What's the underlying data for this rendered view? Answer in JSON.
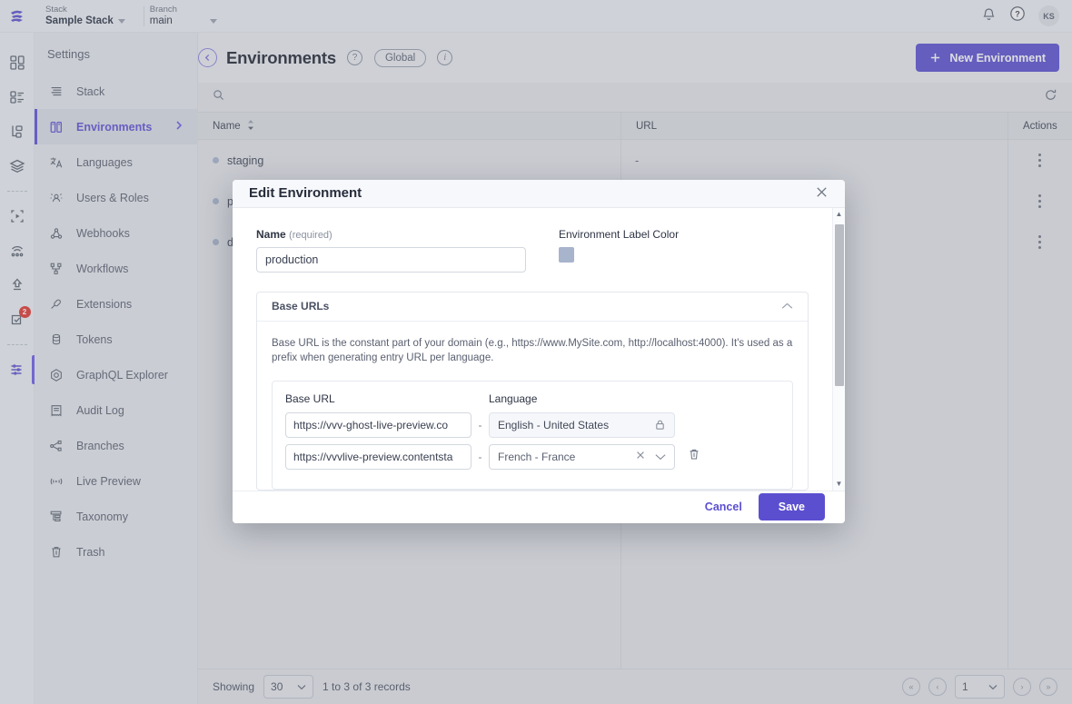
{
  "topbar": {
    "stack_label": "Stack",
    "stack_value": "Sample Stack",
    "branch_label": "Branch",
    "branch_value": "main",
    "avatar_initials": "KS"
  },
  "rail": {
    "items": [
      {
        "name": "dashboard-icon"
      },
      {
        "name": "content-types-icon"
      },
      {
        "name": "entries-icon"
      },
      {
        "name": "assets-icon"
      },
      {
        "name": "live-preview-icon"
      },
      {
        "name": "releases-icon"
      },
      {
        "name": "publish-queue-icon"
      },
      {
        "name": "tasks-icon",
        "badge": "2"
      },
      {
        "name": "settings-icon"
      }
    ]
  },
  "sidebar": {
    "title": "Settings",
    "items": [
      {
        "label": "Stack",
        "icon": "stack-icon",
        "active": false
      },
      {
        "label": "Environments",
        "icon": "environments-icon",
        "active": true
      },
      {
        "label": "Languages",
        "icon": "languages-icon",
        "active": false
      },
      {
        "label": "Users & Roles",
        "icon": "users-roles-icon",
        "active": false
      },
      {
        "label": "Webhooks",
        "icon": "webhooks-icon",
        "active": false
      },
      {
        "label": "Workflows",
        "icon": "workflows-icon",
        "active": false
      },
      {
        "label": "Extensions",
        "icon": "extensions-icon",
        "active": false
      },
      {
        "label": "Tokens",
        "icon": "tokens-icon",
        "active": false
      },
      {
        "label": "GraphQL Explorer",
        "icon": "graphql-icon",
        "active": false
      },
      {
        "label": "Audit Log",
        "icon": "audit-log-icon",
        "active": false
      },
      {
        "label": "Branches",
        "icon": "branches-icon",
        "active": false
      },
      {
        "label": "Live Preview",
        "icon": "live-preview-icon",
        "active": false
      },
      {
        "label": "Taxonomy",
        "icon": "taxonomy-icon",
        "active": false
      },
      {
        "label": "Trash",
        "icon": "trash-icon",
        "active": false
      }
    ]
  },
  "page": {
    "title": "Environments",
    "scope_badge": "Global",
    "new_button": "New Environment"
  },
  "table": {
    "search_placeholder": "",
    "columns": [
      "Name",
      "URL",
      "Actions"
    ],
    "rows": [
      {
        "name": "staging",
        "url": "-"
      },
      {
        "name": "production",
        "url": "-"
      },
      {
        "name": "development",
        "url": "-"
      }
    ]
  },
  "pager": {
    "showing_label": "Showing",
    "page_size": "30",
    "records_label": "1 to 3 of 3 records",
    "current_page": "1"
  },
  "modal": {
    "title": "Edit Environment",
    "name_label": "Name",
    "name_required": "(required)",
    "name_value": "production",
    "color_label": "Environment Label Color",
    "color_value": "#a8b4cc",
    "accordion_title": "Base URLs",
    "help_text": "Base URL is the constant part of your domain (e.g., https://www.MySite.com, http://localhost:4000). It's used as a prefix when generating entry URL per language.",
    "col_base_url": "Base URL",
    "col_language": "Language",
    "rows": [
      {
        "url": "https://vvv-ghost-live-preview.co",
        "separator": "-",
        "language": "English - United States",
        "locked": true
      },
      {
        "url": "https://vvvlive-preview.contentsta",
        "separator": "-",
        "language": "French - France",
        "locked": false
      }
    ],
    "cancel_label": "Cancel",
    "save_label": "Save"
  },
  "colors": {
    "accent": "#5b4fd0",
    "badge_red": "#e2352d"
  }
}
